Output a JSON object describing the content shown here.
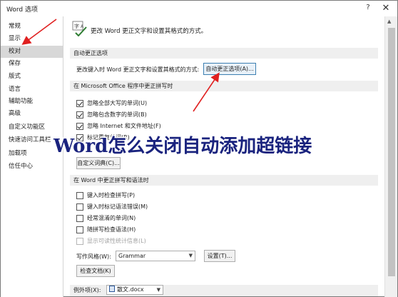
{
  "window": {
    "title": "Word 选项",
    "help_glyph": "?",
    "close_glyph": "✕"
  },
  "sidebar": {
    "items": [
      {
        "label": "常规"
      },
      {
        "label": "显示"
      },
      {
        "label": "校对",
        "active": true
      },
      {
        "label": "保存"
      },
      {
        "label": "版式"
      },
      {
        "label": "语言"
      },
      {
        "label": "辅助功能"
      },
      {
        "label": "高级"
      },
      {
        "label": "自定义功能区"
      },
      {
        "label": "快速访问工具栏"
      },
      {
        "label": "加载项"
      },
      {
        "label": "信任中心"
      }
    ]
  },
  "header": {
    "text": "更改 Word 更正文字和设置其格式的方式。"
  },
  "autocorrect": {
    "section_title": "自动更正选项",
    "row_label": "更改键入时 Word 更正文字和设置其格式的方式:",
    "button_label": "自动更正选项(A)..."
  },
  "office_spelling": {
    "section_title": "在 Microsoft Office 程序中更正拼写时",
    "options": [
      {
        "label": "忽略全部大写的单词(U)",
        "checked": true
      },
      {
        "label": "忽略包含数字的单词(B)",
        "checked": true
      },
      {
        "label": "忽略 Internet 和文件地址(F)",
        "checked": true
      },
      {
        "label": "标记重复单词(R)",
        "checked": true
      }
    ],
    "custom_dict_button": "自定义词典(C)..."
  },
  "overlay": {
    "text": "Word怎么关闭自动添加超链接"
  },
  "word_spelling": {
    "section_title": "在 Word 中更正拼写和语法时",
    "options": [
      {
        "label": "键入时检查拼写(P)",
        "checked": false,
        "disabled": false
      },
      {
        "label": "键入时标记语法错误(M)",
        "checked": false,
        "disabled": false
      },
      {
        "label": "经常混淆的单词(N)",
        "checked": false,
        "disabled": false
      },
      {
        "label": "随拼写检查语法(H)",
        "checked": false,
        "disabled": false
      },
      {
        "label": "显示可读性统计信息(L)",
        "checked": false,
        "disabled": true
      }
    ],
    "writing_style_label": "写作风格(W):",
    "writing_style_value": "Grammar",
    "settings_button": "设置(T)...",
    "check_document_button": "检查文档(K)"
  },
  "exceptions": {
    "label": "例外项(X):",
    "document_value": "散文.docx"
  },
  "colors": {
    "arrow": "#e02020",
    "overlay_text": "#1a237e"
  }
}
